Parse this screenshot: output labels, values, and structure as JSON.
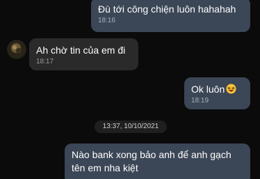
{
  "messages": [
    {
      "direction": "outgoing",
      "text": "Đù tới công chiện luôn hahahah",
      "time": "18:16"
    },
    {
      "direction": "incoming",
      "text": "Ah chờ tin của em đi",
      "time": "18:17"
    },
    {
      "direction": "outgoing",
      "text": "Ok luôn",
      "emoji": "laughing-emoji-icon",
      "time": "18:19"
    },
    {
      "direction": "outgoing",
      "text": "Nào bank xong bảo anh để anh gạch tên em nha kiệt",
      "time": ""
    }
  ],
  "date_separator": "13:37, 10/10/2021",
  "colors": {
    "background": "#0b0b0b",
    "outgoing_bubble": "#3b4656",
    "incoming_bubble": "#2a2a2a",
    "timestamp": "#aab2bd"
  }
}
